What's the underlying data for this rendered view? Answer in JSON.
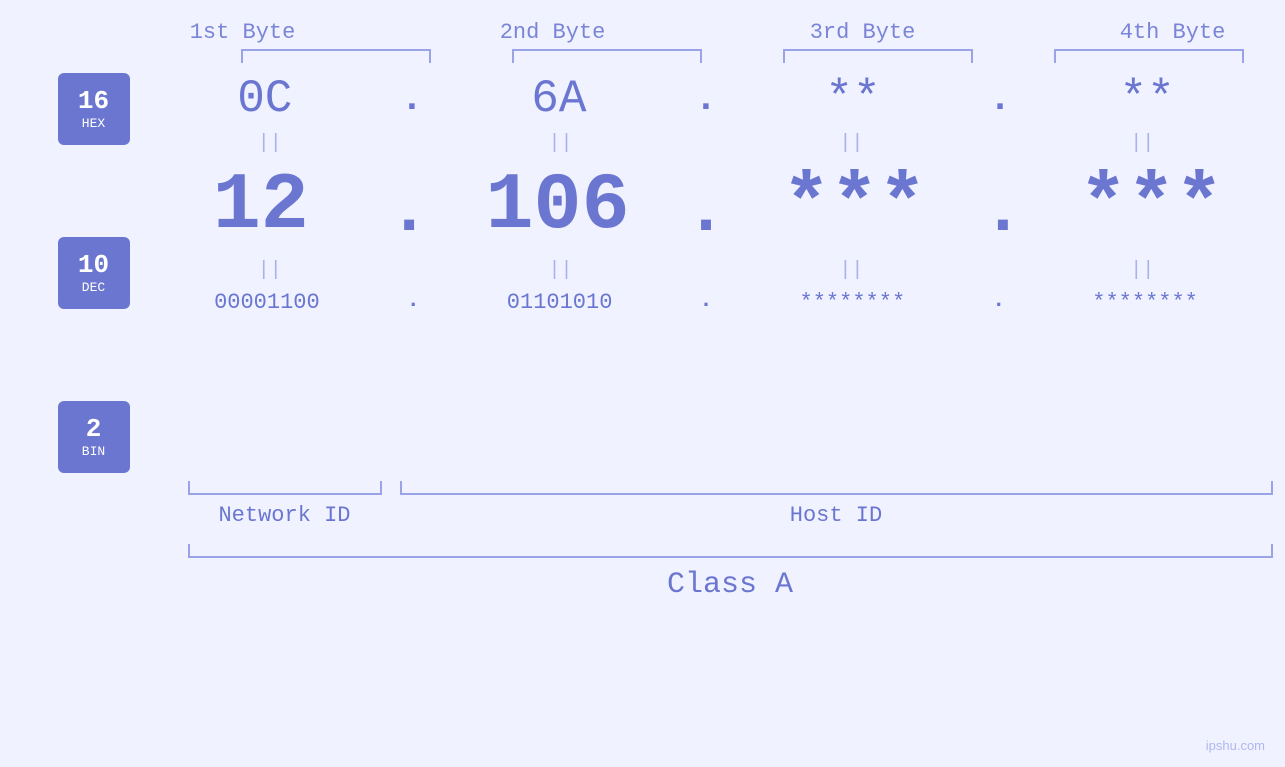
{
  "header": {
    "byte1": "1st Byte",
    "byte2": "2nd Byte",
    "byte3": "3rd Byte",
    "byte4": "4th Byte"
  },
  "bases": [
    {
      "number": "16",
      "name": "HEX"
    },
    {
      "number": "10",
      "name": "DEC"
    },
    {
      "number": "2",
      "name": "BIN"
    }
  ],
  "hex_row": {
    "b1": "0C",
    "b2": "6A",
    "b3": "**",
    "b4": "**",
    "dot": "."
  },
  "dec_row": {
    "b1": "12",
    "b2": "106",
    "b3": "***",
    "b4": "***",
    "dot": "."
  },
  "bin_row": {
    "b1": "00001100",
    "b2": "01101010",
    "b3": "********",
    "b4": "********",
    "dot": "."
  },
  "separators": {
    "symbol": "||"
  },
  "labels": {
    "network_id": "Network ID",
    "host_id": "Host ID",
    "class": "Class A"
  },
  "watermark": "ipshu.com"
}
